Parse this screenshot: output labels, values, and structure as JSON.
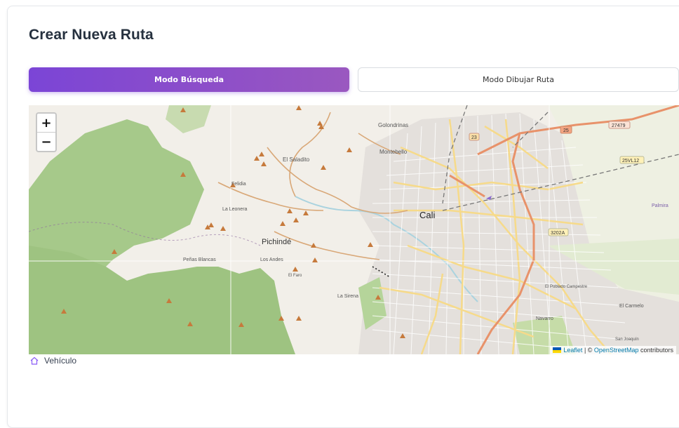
{
  "page": {
    "title": "Crear Nueva Ruta"
  },
  "modes": {
    "search_label": "Modo Búsqueda",
    "draw_label": "Modo Dibujar Ruta",
    "active": "search"
  },
  "map": {
    "zoom_in": "+",
    "zoom_out": "−",
    "labels": {
      "cali": "Cali",
      "pichinde": "Pichindé",
      "la_leonera": "La Leonera",
      "felidia": "Felidia",
      "el_saladito": "El Saladito",
      "montebello": "Montebello",
      "golondrinas": "Golondrinas",
      "los_andes": "Los Andes",
      "el_faro": "El Faro",
      "la_sirena": "La Sirena",
      "el_carmelo": "El Carmelo",
      "navarro": "Navarro",
      "el_poblado_campestre": "El Poblado Campestre",
      "san_joaquin": "San Joaquín",
      "palmira": "Palmira",
      "peñas_blancas": "Peñas Blancas"
    },
    "road_shields": [
      "25",
      "27479",
      "23",
      "25VL12",
      "3202A"
    ],
    "attribution": {
      "leaflet": "Leaflet",
      "separator": " | © ",
      "osm": "OpenStreetMap",
      "suffix": " contributors"
    },
    "colors": {
      "park": "#8fbc6c",
      "water": "#aad3df",
      "highway": "#e8926a",
      "primary": "#f6da8a"
    }
  },
  "vehicle": {
    "label": "Vehículo",
    "icon": "house-icon"
  }
}
